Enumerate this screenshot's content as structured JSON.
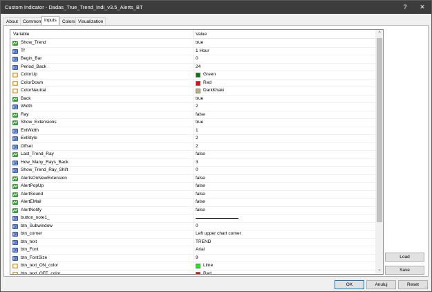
{
  "window": {
    "title": "Custom Indicator - Dadas_True_Trend_Indi_v3.5_Alerts_BT",
    "help_label": "?",
    "close_label": "✕"
  },
  "tabs": [
    {
      "label": "About"
    },
    {
      "label": "Common"
    },
    {
      "label": "Inputs",
      "active": true
    },
    {
      "label": "Colors"
    },
    {
      "label": "Visualization"
    }
  ],
  "grid": {
    "col_variable": "Variable",
    "col_value": "Value"
  },
  "params": [
    {
      "type": "ind",
      "name": "Show_Trend",
      "value": "true"
    },
    {
      "type": "num",
      "name": "Tf",
      "value": "1 Hour"
    },
    {
      "type": "num",
      "name": "Begin_Bar",
      "value": "0"
    },
    {
      "type": "num",
      "name": "Period_Back",
      "value": "24"
    },
    {
      "type": "col",
      "name": "ColorUp",
      "value": "Green",
      "color": "#008000"
    },
    {
      "type": "col",
      "name": "ColorDown",
      "value": "Red",
      "color": "#ff0000"
    },
    {
      "type": "col",
      "name": "ColorNeutral",
      "value": "DarkKhaki",
      "color": "#bdb76b"
    },
    {
      "type": "ind",
      "name": "Back",
      "value": "true"
    },
    {
      "type": "num",
      "name": "Width",
      "value": "2"
    },
    {
      "type": "ind",
      "name": "Ray",
      "value": "false"
    },
    {
      "type": "ind",
      "name": "Show_Extensions",
      "value": "true"
    },
    {
      "type": "num",
      "name": "ExtWidth",
      "value": "1"
    },
    {
      "type": "num",
      "name": "ExtStyle",
      "value": "2"
    },
    {
      "type": "num",
      "name": "Offset",
      "value": "2"
    },
    {
      "type": "ind",
      "name": "Last_Trend_Ray",
      "value": "false"
    },
    {
      "type": "num",
      "name": "How_Many_Rays_Back",
      "value": "3"
    },
    {
      "type": "num",
      "name": "Show_Trend_Ray_Shift",
      "value": "0"
    },
    {
      "type": "ind",
      "name": "AlertsOnNewExtension",
      "value": "false"
    },
    {
      "type": "ind",
      "name": "AlertPopUp",
      "value": "false"
    },
    {
      "type": "ind",
      "name": "AlertSound",
      "value": "false"
    },
    {
      "type": "ind",
      "name": "AlertEMail",
      "value": "false"
    },
    {
      "type": "ind",
      "name": "AlertNotify",
      "value": "false"
    },
    {
      "type": "txt",
      "name": "button_note1_",
      "value": "",
      "line": true
    },
    {
      "type": "num",
      "name": "btn_Subwindow",
      "value": "0"
    },
    {
      "type": "num",
      "name": "btn_corner",
      "value": "Left upper chart corner"
    },
    {
      "type": "txt",
      "name": "btn_text",
      "value": "TREND"
    },
    {
      "type": "txt",
      "name": "btn_Font",
      "value": "Arial"
    },
    {
      "type": "num",
      "name": "btn_FontSize",
      "value": "9"
    },
    {
      "type": "col",
      "name": "btn_text_ON_color",
      "value": "Lime",
      "color": "#00ff00"
    },
    {
      "type": "col",
      "name": "btn_text_OFF_color",
      "value": "Red",
      "color": "#ff0000"
    }
  ],
  "buttons": {
    "load": "Load",
    "save": "Save",
    "ok": "OK",
    "cancel": "Anuluj",
    "reset": "Reset"
  },
  "colors": {
    "titlebar": "#3c3c3c",
    "ind_icon": "#3a9d3a",
    "num_icon": "#3b5fb8",
    "col_icon": "#e2a23a",
    "accent": "#0078d7"
  }
}
